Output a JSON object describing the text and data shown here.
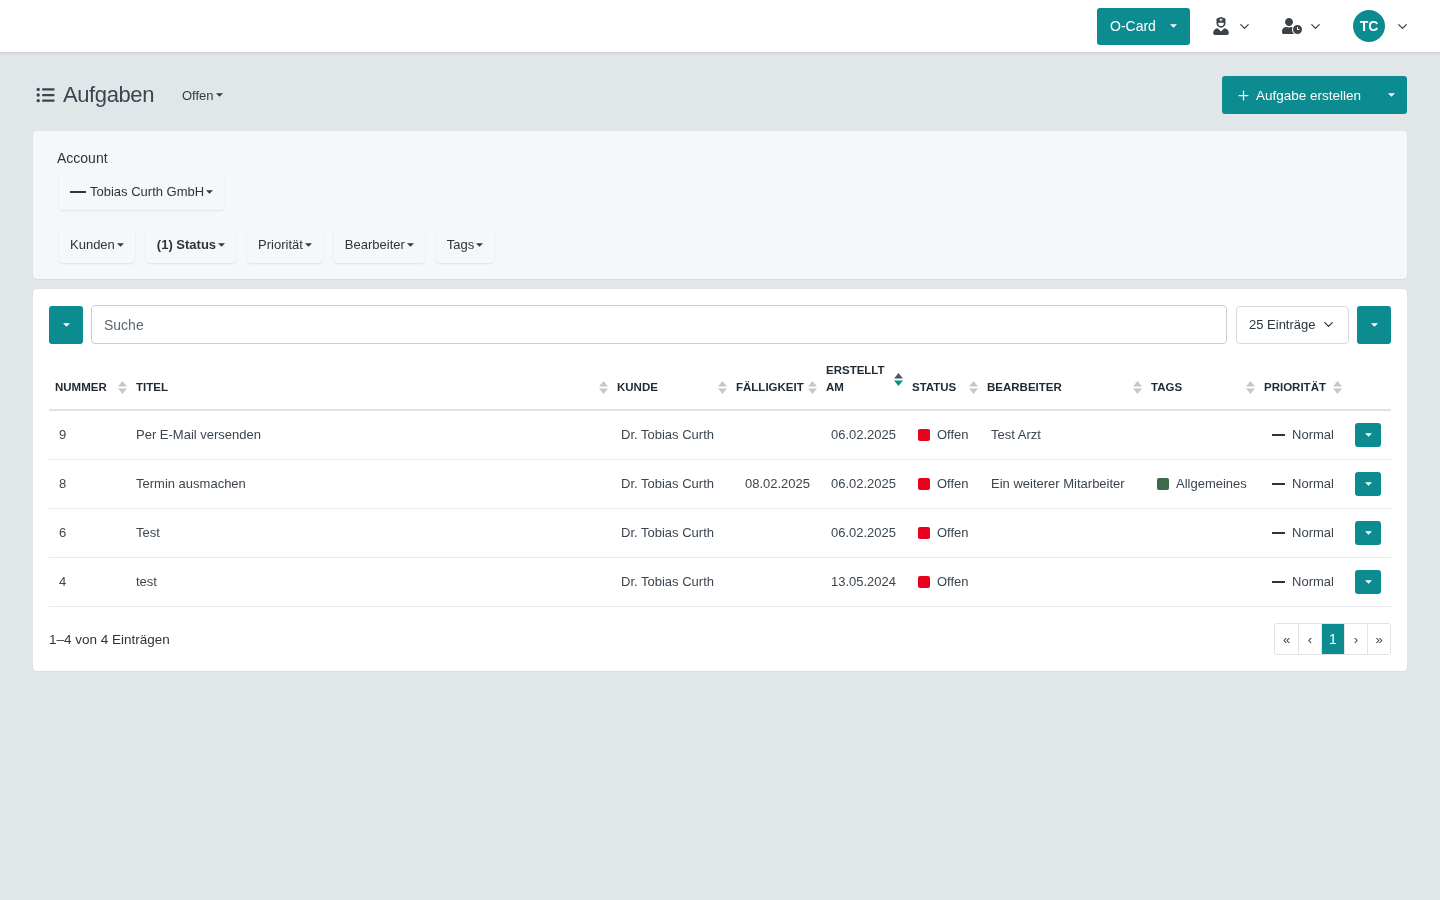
{
  "top_bar": {
    "card_button": {
      "label": "O-Card"
    },
    "avatar": {
      "initials": "TC"
    }
  },
  "page_header": {
    "title": "Aufgaben",
    "view_filter": "Offen",
    "create_button": "Aufgabe erstellen"
  },
  "filters": {
    "account_label": "Account",
    "account": "Tobias Curth GmbH",
    "buttons": [
      {
        "label": "Kunden",
        "active": false
      },
      {
        "label": "(1) Status",
        "active": true
      },
      {
        "label": "Priorität",
        "active": false
      },
      {
        "label": "Bearbeiter",
        "active": false
      },
      {
        "label": "Tags",
        "active": false
      }
    ]
  },
  "table_toolbar": {
    "search": {
      "placeholder": "Suche"
    },
    "page_size": "25 Einträge"
  },
  "table": {
    "columns": [
      {
        "label": "NUMMER",
        "sorted": false
      },
      {
        "label": "TITEL",
        "sorted": false
      },
      {
        "label": "KUNDE",
        "sorted": false
      },
      {
        "label": "FÄLLIGKEIT",
        "sorted": false
      },
      {
        "label": "ERSTELLT AM",
        "sorted": true
      },
      {
        "label": "STATUS",
        "sorted": false
      },
      {
        "label": "BEARBEITER",
        "sorted": false
      },
      {
        "label": "TAGS",
        "sorted": false
      },
      {
        "label": "PRIORITÄT",
        "sorted": false
      }
    ],
    "rows": [
      {
        "number": "9",
        "title": "Per E-Mail versenden",
        "customer": "Dr. Tobias Curth",
        "created": "06.02.2025",
        "status": {
          "label": "Offen",
          "color": "#e8001d"
        },
        "assignee": "Test Arzt",
        "priority": "Normal"
      },
      {
        "number": "8",
        "title": "Termin ausmachen",
        "customer": "Dr. Tobias Curth",
        "due": "08.02.2025",
        "created": "06.02.2025",
        "status": {
          "label": "Offen",
          "color": "#e8001d"
        },
        "assignee": "Ein weiterer Mitarbeiter",
        "tags": [
          {
            "label": "Allgemeines",
            "color": "#3f6a4a"
          }
        ],
        "priority": "Normal"
      },
      {
        "number": "6",
        "title": "Test",
        "customer": "Dr. Tobias Curth",
        "created": "06.02.2025",
        "status": {
          "label": "Offen",
          "color": "#e8001d"
        },
        "priority": "Normal"
      },
      {
        "number": "4",
        "title": "test",
        "customer": "Dr. Tobias Curth",
        "created": "13.05.2024",
        "status": {
          "label": "Offen",
          "color": "#e8001d"
        },
        "priority": "Normal"
      }
    ]
  },
  "footer": {
    "summary": "1–4 von 4 Einträgen",
    "pagination": {
      "first": "«",
      "prev": "‹",
      "pages": [
        {
          "label": "1",
          "selected": true
        }
      ],
      "next": "›",
      "last": "»"
    }
  }
}
